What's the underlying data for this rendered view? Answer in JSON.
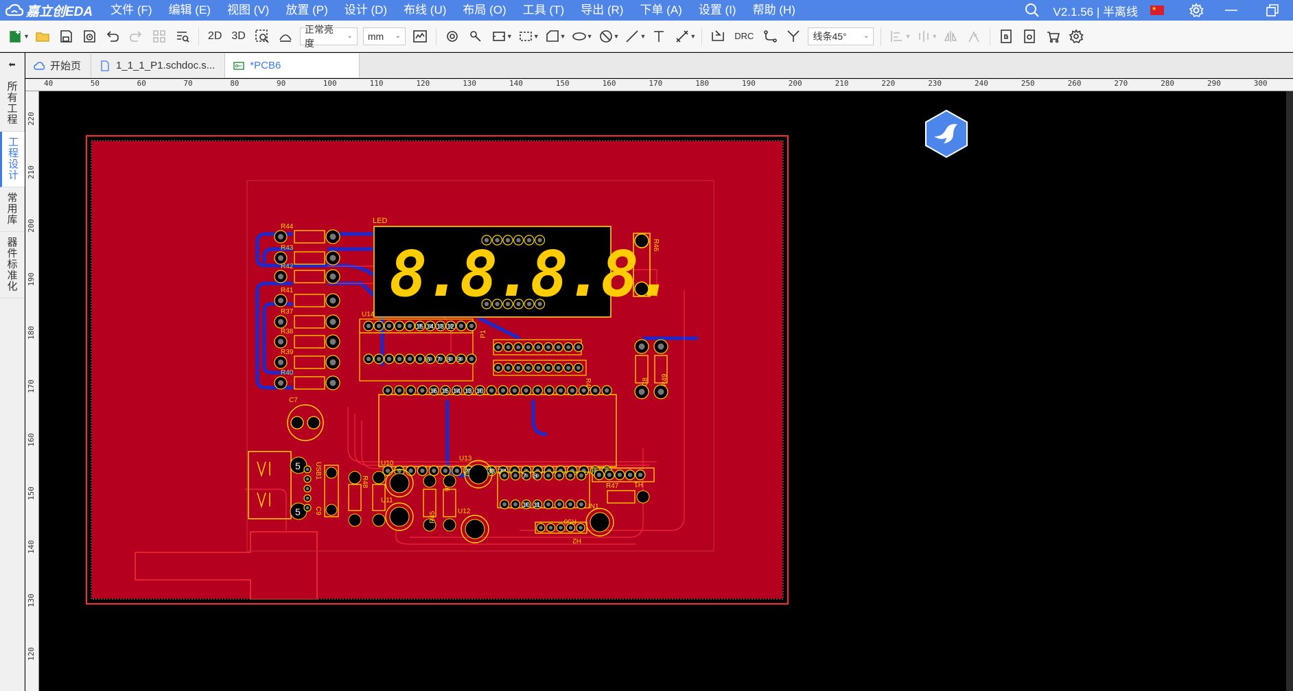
{
  "app": {
    "brand": "嘉立创EDA",
    "version_label": "V2.1.56 | 半离线"
  },
  "menu": [
    {
      "label": "文件 (F)"
    },
    {
      "label": "编辑 (E)"
    },
    {
      "label": "视图 (V)"
    },
    {
      "label": "放置 (P)"
    },
    {
      "label": "设计 (D)"
    },
    {
      "label": "布线 (U)"
    },
    {
      "label": "布局 (O)"
    },
    {
      "label": "工具 (T)"
    },
    {
      "label": "导出 (R)"
    },
    {
      "label": "下单 (A)"
    },
    {
      "label": "设置 (I)"
    },
    {
      "label": "帮助 (H)"
    }
  ],
  "toolbar": {
    "view_2d": "2D",
    "view_3d": "3D",
    "brightness": "正常亮度",
    "unit": "mm",
    "drc": "DRC",
    "route_mode": "线条45°"
  },
  "leftnav": {
    "items": [
      {
        "label": "所有工程",
        "active": false
      },
      {
        "label": "工程设计",
        "active": true
      },
      {
        "label": "常用库",
        "active": false
      },
      {
        "label": "器件标准化",
        "active": false
      }
    ]
  },
  "tabs": [
    {
      "label": "开始页",
      "icon": "cloud-icon",
      "active": false
    },
    {
      "label": "1_1_1_P1.schdoc.s...",
      "icon": "document-icon",
      "active": false
    },
    {
      "label": "*PCB6",
      "icon": "pcb-icon",
      "active": true
    }
  ],
  "ruler": {
    "top": [
      "40",
      "50",
      "60",
      "70",
      "80",
      "90",
      "100",
      "110",
      "120",
      "130",
      "140",
      "150",
      "160",
      "170",
      "180",
      "190",
      "200",
      "210",
      "220",
      "230",
      "240",
      "250",
      "260",
      "270",
      "280",
      "290",
      "300"
    ],
    "left": [
      "220",
      "210",
      "200",
      "190",
      "180",
      "170",
      "160",
      "150",
      "140",
      "130",
      "120"
    ]
  },
  "pcb": {
    "resistor_labels": [
      "R44",
      "R43",
      "R42",
      "R41",
      "R37",
      "R38",
      "R39",
      "R40"
    ],
    "led_label": "LED",
    "display_text": "8.8.8.8.",
    "labels": [
      "C7",
      "USB1",
      "C9",
      "R48",
      "U10",
      "U11",
      "R46",
      "R45",
      "U13",
      "U12",
      "U14",
      "P1",
      "C8",
      "R49",
      "R47",
      "IN1",
      "R50",
      "U9",
      "U15",
      "H1",
      "H2"
    ],
    "pin_numbers_u14_top": [
      "15",
      "14",
      "13",
      "12"
    ],
    "pin_numbers_u14_bottom": [
      "6",
      "7",
      "8",
      "9"
    ],
    "pin_numbers_chip_top": [
      "16",
      "15",
      "14",
      "13",
      "10"
    ],
    "pin_numbers_chip_bottom": [
      "27",
      "28",
      "33",
      "34"
    ],
    "pin_numbers_u13": [
      "7",
      "8"
    ],
    "pin_numbers_u13b": [
      "10",
      "11"
    ],
    "usb_pins": [
      "5",
      "5"
    ]
  },
  "colors": {
    "menubar": "#4f85e6",
    "board_fill": "#b5001f",
    "silkscreen": "#ffd400",
    "bottom_trace": "#1a2ad0",
    "accent": "#3d7bf0"
  }
}
